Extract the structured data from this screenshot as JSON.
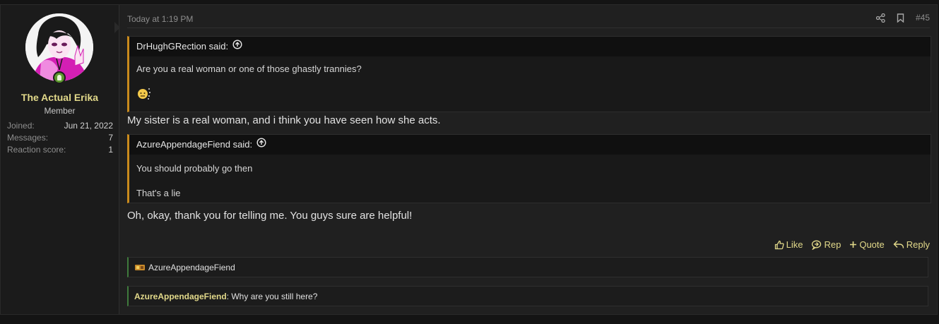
{
  "user": {
    "name": "The Actual Erika",
    "title": "Member",
    "stats": [
      {
        "label": "Joined:",
        "value": "Jun 21, 2022"
      },
      {
        "label": "Messages:",
        "value": "7"
      },
      {
        "label": "Reaction score:",
        "value": "1"
      }
    ]
  },
  "post": {
    "date": "Today at 1:19 PM",
    "number": "#45",
    "quotes": [
      {
        "author": "DrHughGRection said:",
        "lines": [
          "Are you a real woman or one of those ghastly trannies?"
        ]
      },
      {
        "author": "AzureAppendageFiend said:",
        "lines": [
          "You should probably go then",
          "That's a lie"
        ]
      }
    ],
    "messages": [
      "My sister is a real woman, and i think you have seen how she acts.",
      "Oh, okay, thank you for telling me. You guys sure are helpful!"
    ]
  },
  "actions": {
    "like": "Like",
    "rep": "Rep",
    "quote": "Quote",
    "reply": "Reply"
  },
  "reactions": {
    "reacted_user": "AzureAppendageFiend"
  },
  "comment": {
    "author": "AzureAppendageFiend",
    "text": ": Why are you still here?"
  },
  "colors": {
    "accent": "#e2d98a",
    "quote_border": "#c98a1c",
    "online": "#5e9a2e"
  }
}
